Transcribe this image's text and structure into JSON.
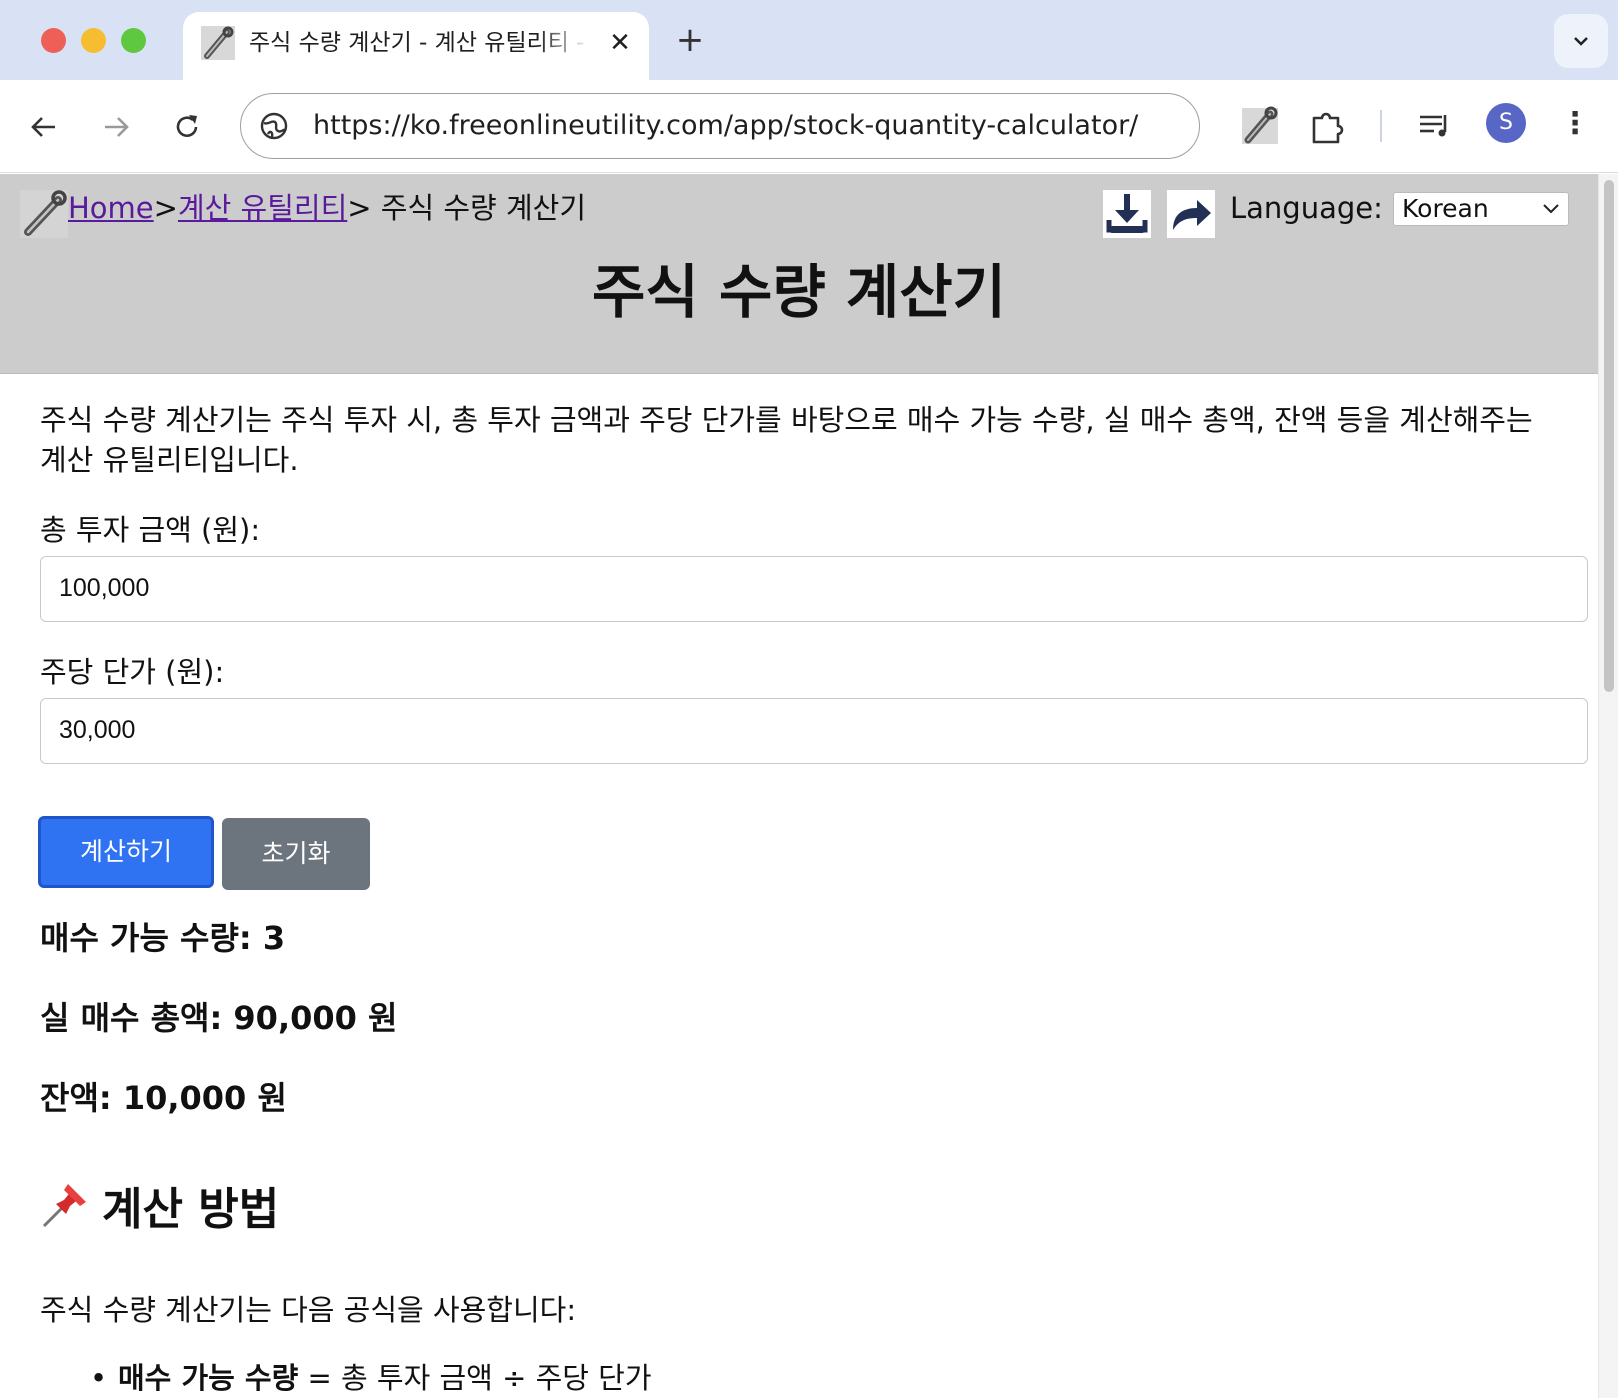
{
  "browser": {
    "tab_title": "주식 수량 계산기 - 계산 유틸리티 - Free Online Utility",
    "tab_close": "✕",
    "new_tab": "+",
    "url": "https://ko.freeonlineutility.com/app/stock-quantity-calculator/",
    "avatar_letter": "S"
  },
  "header": {
    "breadcrumb": {
      "home": "Home",
      "sep1": ">",
      "category": "계산 유틸리티",
      "sep2": ">",
      "current": " 주식 수량 계산기"
    },
    "language_label": "Language:",
    "language_value": "Korean",
    "title": "주식 수량 계산기"
  },
  "main": {
    "intro": "주식 수량 계산기는 주식 투자 시, 총 투자 금액과 주당 단가를 바탕으로 매수 가능 수량, 실 매수 총액, 잔액 등을 계산해주는 계산 유틸리티입니다.",
    "fields": [
      {
        "label": "총 투자 금액 (원):",
        "value": "100,000"
      },
      {
        "label": "주당 단가 (원):",
        "value": "30,000"
      }
    ],
    "buttons": {
      "calculate": "계산하기",
      "reset": "초기화"
    },
    "results": [
      "매수 가능 수량: 3",
      "실 매수 총액: 90,000 원",
      "잔액: 10,000 원"
    ],
    "method": {
      "title": "계산 방법",
      "text": "주식 수량 계산기는 다음 공식을 사용합니다:",
      "formula_term": "매수 가능 수량",
      "formula_rest": " = 총 투자 금액 ÷ 주당 단가"
    }
  },
  "icons": [
    "wrench-icon",
    "globe-icon",
    "download-icon",
    "share-icon",
    "puzzle-icon",
    "media-icon",
    "pin-icon"
  ],
  "colors": {
    "header_bg": "#cccccc",
    "calculate_btn": "#2f73f2",
    "reset_btn": "#6c757d",
    "link": "#5a1a9c"
  }
}
